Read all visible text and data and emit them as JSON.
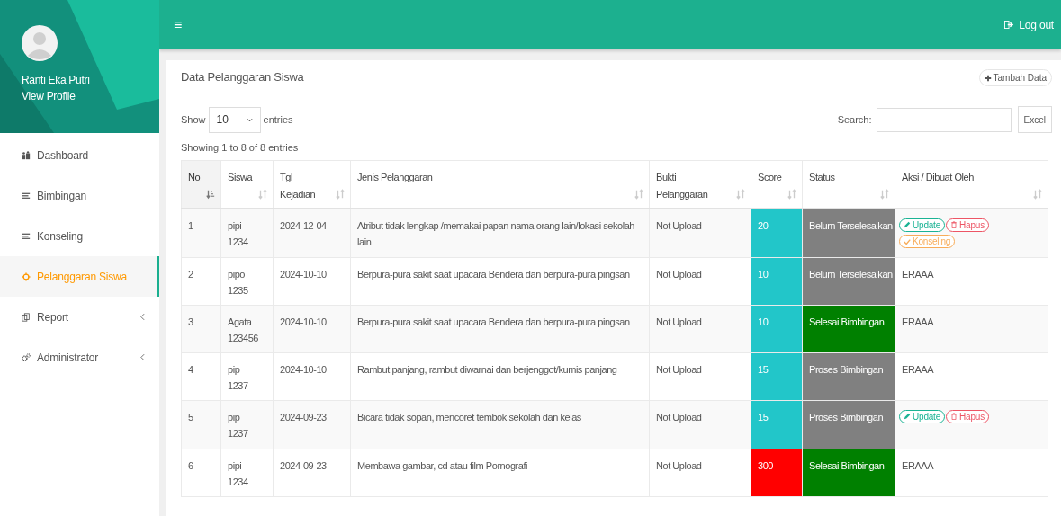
{
  "sidebar": {
    "user_name": "Ranti Eka Putri",
    "profile_link": "View Profile",
    "items": [
      {
        "label": "Dashboard",
        "selected": false,
        "has_submenu": false
      },
      {
        "label": "Bimbingan",
        "selected": false,
        "has_submenu": false
      },
      {
        "label": "Konseling",
        "selected": false,
        "has_submenu": false
      },
      {
        "label": "Pelanggaran Siswa",
        "selected": true,
        "has_submenu": false
      },
      {
        "label": "Report",
        "selected": false,
        "has_submenu": true
      },
      {
        "label": "Administrator",
        "selected": false,
        "has_submenu": true
      }
    ]
  },
  "topbar": {
    "menu_icon": "≡",
    "logout": "Log out"
  },
  "panel": {
    "title": "Data Pelanggaran Siswa",
    "add_button": "Tambah Data",
    "length": {
      "before": "Show",
      "value": "10",
      "after": "entries"
    },
    "search_label": "Search:",
    "excel_button": "Excel",
    "info": "Showing 1 to 8 of 8 entries",
    "table": {
      "columns": [
        {
          "lines": [
            "No"
          ],
          "sorted": true
        },
        {
          "lines": [
            "Siswa"
          ],
          "sorted": false
        },
        {
          "lines": [
            "Tgl",
            "Kejadian"
          ],
          "sorted": false
        },
        {
          "lines": [
            "Jenis Pelanggaran"
          ],
          "sorted": false
        },
        {
          "lines": [
            "Bukti",
            "Pelanggaran"
          ],
          "sorted": false
        },
        {
          "lines": [
            "Score"
          ],
          "sorted": false
        },
        {
          "lines": [
            "Status"
          ],
          "sorted": false
        },
        {
          "lines": [
            "Aksi / Dibuat Oleh"
          ],
          "sorted": false
        }
      ],
      "rows": [
        {
          "no": "1",
          "siswa": [
            "pipi",
            "1234"
          ],
          "tgl": "2024-12-04",
          "jenis": "Atribut tidak lengkap /memakai papan nama orang lain/lokasi sekolah lain",
          "bukti": "Not Upload",
          "score": {
            "text": "20",
            "color": "#22c6c9"
          },
          "status": {
            "text": "Belum Terselesaikan",
            "color": "#808080"
          },
          "aksi": [
            {
              "kind": "update",
              "label": "Update"
            },
            {
              "kind": "hapus",
              "label": "Hapus"
            },
            {
              "kind": "konseling",
              "label": "Konseling"
            }
          ]
        },
        {
          "no": "2",
          "siswa": [
            "pipo",
            "1235"
          ],
          "tgl": "2024-10-10",
          "jenis": "Berpura-pura sakit saat upacara Bendera dan berpura-pura pingsan",
          "bukti": "Not Upload",
          "score": {
            "text": "10",
            "color": "#22c6c9"
          },
          "status": {
            "text": "Belum Terselesaikan",
            "color": "#808080"
          },
          "dibuat_oleh": "ERAAA"
        },
        {
          "no": "3",
          "siswa": [
            "Agata",
            "123456"
          ],
          "tgl": "2024-10-10",
          "jenis": "Berpura-pura sakit saat upacara Bendera dan berpura-pura pingsan",
          "bukti": "Not Upload",
          "score": {
            "text": "10",
            "color": "#22c6c9"
          },
          "status": {
            "text": "Selesai Bimbingan",
            "color": "#008000"
          },
          "dibuat_oleh": "ERAAA"
        },
        {
          "no": "4",
          "siswa": [
            "pip",
            "1237"
          ],
          "tgl": "2024-10-10",
          "jenis": "Rambut panjang, rambut diwarnai dan berjenggot/kumis panjang",
          "bukti": "Not Upload",
          "score": {
            "text": "15",
            "color": "#22c6c9"
          },
          "status": {
            "text": "Proses Bimbingan",
            "color": "#808080"
          },
          "dibuat_oleh": "ERAAA"
        },
        {
          "no": "5",
          "siswa": [
            "pip",
            "1237"
          ],
          "tgl": "2024-09-23",
          "jenis": "Bicara tidak sopan, mencoret tembok sekolah dan kelas",
          "bukti": "Not Upload",
          "score": {
            "text": "15",
            "color": "#22c6c9"
          },
          "status": {
            "text": "Proses Bimbingan",
            "color": "#808080"
          },
          "aksi": [
            {
              "kind": "update",
              "label": "Update"
            },
            {
              "kind": "hapus",
              "label": "Hapus"
            }
          ]
        },
        {
          "no": "6",
          "siswa": [
            "pipi",
            "1234"
          ],
          "tgl": "2024-09-23",
          "jenis": "Membawa gambar, cd atau film Pornografi",
          "bukti": "Not Upload",
          "score": {
            "text": "300",
            "color": "#ff0000"
          },
          "status": {
            "text": "Selesai Bimbingan",
            "color": "#008000"
          },
          "dibuat_oleh": "ERAAA"
        }
      ]
    }
  }
}
